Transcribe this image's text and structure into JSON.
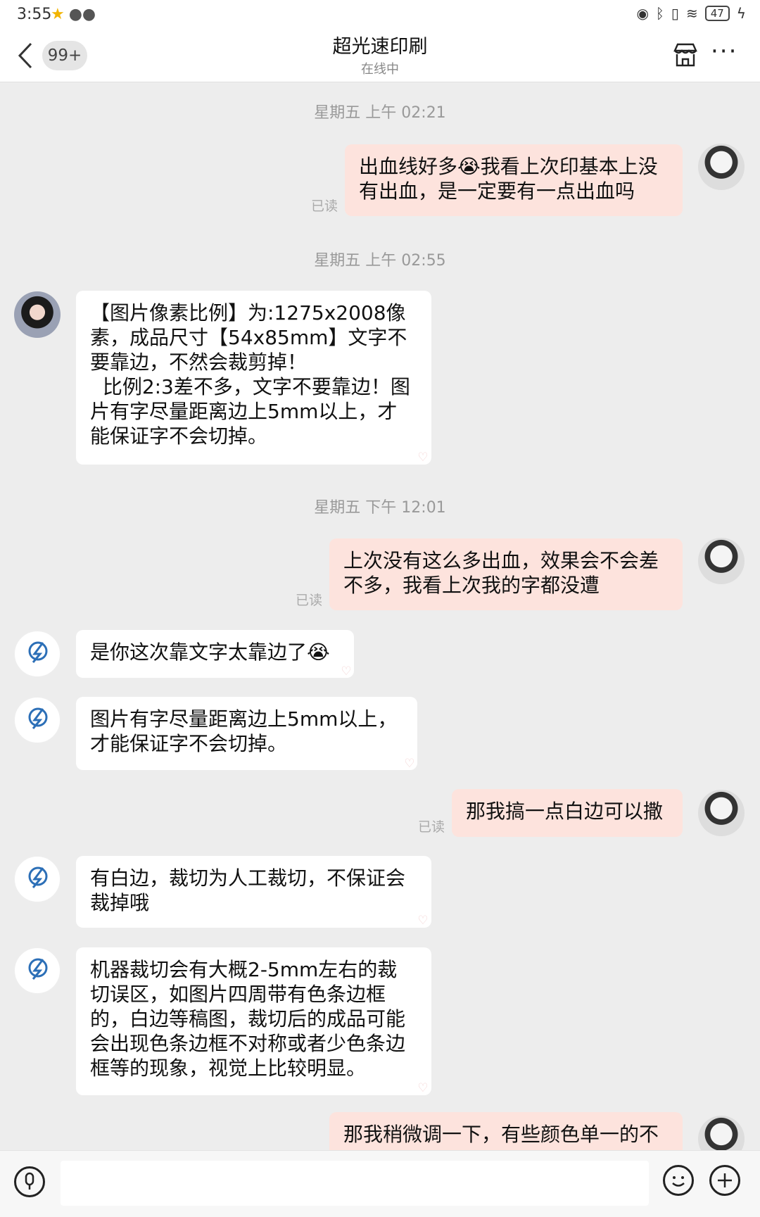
{
  "status_bar": {
    "time": "3:55",
    "battery": "47"
  },
  "header": {
    "unread": "99+",
    "title": "超光速印刷",
    "subtitle": "在线中"
  },
  "read_label": "已读",
  "timestamps": [
    "星期五 上午 02:21",
    "星期五 上午 02:55",
    "星期五 下午 12:01"
  ],
  "messages": [
    {
      "from": "me",
      "text": "出血线好多😭我看上次印基本上没\n有出血，是一定要有一点出血吗"
    },
    {
      "from": "agent",
      "text": "【图片像素比例】为:1275x2008像\n素，成品尺寸【54x85mm】文字不\n要靠边，不然会裁剪掉！\n  比例2:3差不多，文字不要靠边！图\n片有字尽量距离边上5mm以上，才\n能保证字不会切掉。"
    },
    {
      "from": "me",
      "text": "上次没有这么多出血，效果会不会差\n不多，我看上次我的字都没遭"
    },
    {
      "from": "shop",
      "text": "是你这次靠文字太靠边了😭"
    },
    {
      "from": "shop",
      "text": "图片有字尽量距离边上5mm以上，\n才能保证字不会切掉。"
    },
    {
      "from": "me",
      "text": "那我搞一点白边可以撒"
    },
    {
      "from": "shop",
      "text": "有白边，裁切为人工裁切，不保证会\n裁掉哦"
    },
    {
      "from": "shop",
      "text": "机器裁切会有大概2-5mm左右的裁\n切误区，如图片四周带有色条边框\n的，白边等稿图，裁切后的成品可能\n会出现色条边框不对称或者少色条边\n框等的现象，视觉上比较明显。"
    },
    {
      "from": "me",
      "text": "那我稍微调一下，有些颜色单一的不"
    }
  ],
  "shop_logo_text": "超光速印刷",
  "input": {
    "placeholder": ""
  }
}
